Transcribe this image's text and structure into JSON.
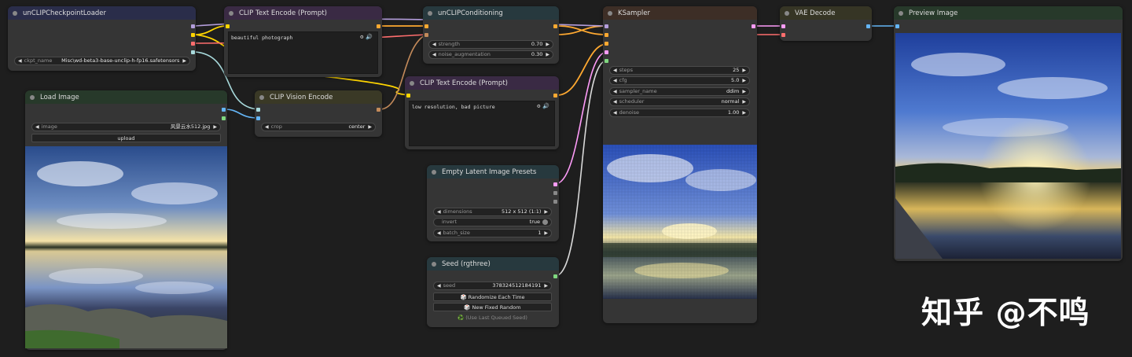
{
  "colors": {
    "canvas_bg": "#1e1e1e",
    "node_bg": "#353535",
    "wire_clip": "#ffd500",
    "wire_conditioning": "#ffa931",
    "wire_model": "#b39ddb",
    "wire_vae": "#ff6e6e",
    "wire_image": "#64b5f6",
    "wire_latent": "#ff9cf9",
    "wire_clip_vision": "#a8dadc",
    "wire_int": "#7fd77f"
  },
  "nodes": {
    "ckpt_loader": {
      "title": "unCLIPCheckpointLoader",
      "widgets": [
        {
          "label": "ckpt_name",
          "value": "Misc\\wd-beta3-base-unclip-h-fp16.safetensors"
        }
      ]
    },
    "clip_text_pos": {
      "title": "CLIP Text Encode (Prompt)",
      "text": "beautiful photograph"
    },
    "clip_text_neg": {
      "title": "CLIP Text Encode (Prompt)",
      "text": "low resolution, bad picture"
    },
    "unclip_cond": {
      "title": "unCLIPConditioning",
      "widgets": [
        {
          "label": "strength",
          "value": "0.70"
        },
        {
          "label": "noise_augmentation",
          "value": "0.30"
        }
      ]
    },
    "ksampler": {
      "title": "KSampler",
      "widgets": [
        {
          "label": "steps",
          "value": "25"
        },
        {
          "label": "cfg",
          "value": "5.0"
        },
        {
          "label": "sampler_name",
          "value": "ddim"
        },
        {
          "label": "scheduler",
          "value": "normal"
        },
        {
          "label": "denoise",
          "value": "1.00"
        }
      ]
    },
    "vae_decode": {
      "title": "VAE Decode"
    },
    "preview_image": {
      "title": "Preview Image"
    },
    "load_image": {
      "title": "Load Image",
      "widgets": [
        {
          "label": "image",
          "value": "风景云水512.jpg"
        }
      ],
      "upload_label": "upload"
    },
    "clip_vision": {
      "title": "CLIP Vision Encode",
      "widgets": [
        {
          "label": "crop",
          "value": "center"
        }
      ]
    },
    "empty_latent": {
      "title": "Empty Latent Image Presets",
      "widgets": [
        {
          "label": "dimensions",
          "value": "512 x 512 (1:1)"
        },
        {
          "label": "invert",
          "value": "true"
        },
        {
          "label": "batch_size",
          "value": "1"
        }
      ]
    },
    "seed": {
      "title": "Seed (rgthree)",
      "widgets": [
        {
          "label": "seed",
          "value": "378324512184191"
        }
      ],
      "buttons": [
        "🎲 Randomize Each Time",
        "🎲 New Fixed Random"
      ],
      "hint": "♻️ (Use Last Queued Seed)"
    }
  },
  "watermark": "知乎 @不鸣"
}
